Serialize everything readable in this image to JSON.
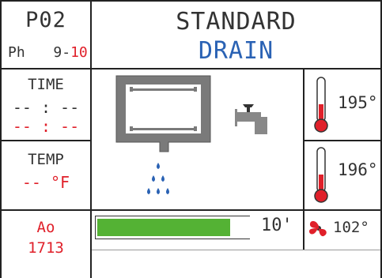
{
  "program": {
    "code": "P02",
    "phase_prefix": "Ph",
    "phase_current": "9-",
    "phase_total": "10"
  },
  "header": {
    "recipe_name": "STANDARD",
    "step_name": "DRAIN"
  },
  "time_panel": {
    "label": "TIME",
    "elapsed": "-- : --",
    "remaining": "-- : --"
  },
  "temp_panel": {
    "label": "TEMP",
    "value": "--",
    "unit": "°F"
  },
  "ao_panel": {
    "label": "Ao",
    "value": "1713"
  },
  "sensors": {
    "temp_top": "195°",
    "temp_bottom": "196°",
    "fan_temp": "102°"
  },
  "progress": {
    "fraction": 0.88,
    "label": "10'"
  },
  "colors": {
    "red": "#e0202a",
    "blue": "#2a62b4",
    "green": "#54b234",
    "gray": "#7a7a7a"
  },
  "icons": [
    "chamber-icon",
    "faucet-icon",
    "drain-drops-icon",
    "thermometer-icon",
    "fan-icon"
  ]
}
